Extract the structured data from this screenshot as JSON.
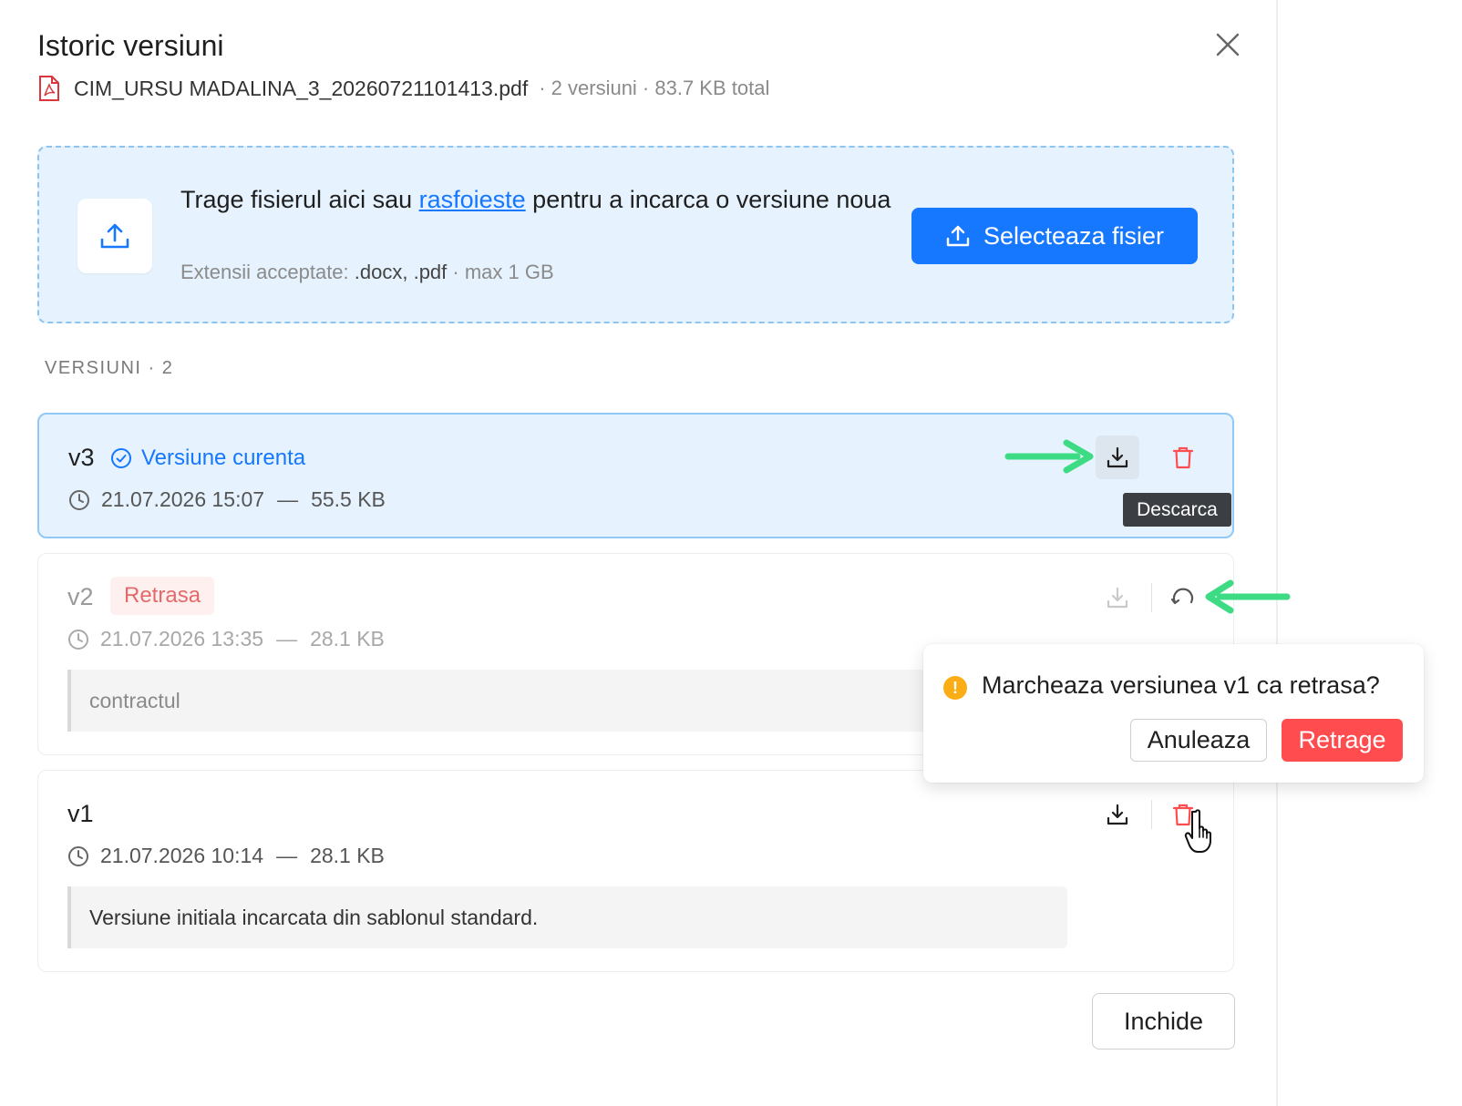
{
  "modal": {
    "title": "Istoric versiuni",
    "file_name": "CIM_URSU MADALINA_3_20260721101413.pdf",
    "file_meta": "· 2 versiuni · 83.7 KB total"
  },
  "dropzone": {
    "text_before": "Trage fisierul aici sau ",
    "link": "rasfoieste",
    "text_after": " pentru a incarca o versiune noua",
    "sub_label": "Extensii acceptate: ",
    "extensions": ".docx, .pdf",
    "max_size": " · max 1 GB",
    "button_label": "Selecteaza fisier"
  },
  "versions_label": "VERSIUNI · 2",
  "versions": [
    {
      "version": "v3",
      "status": "Versiune curenta",
      "date": "21.07.2026 15:07",
      "dash": "—",
      "size": "55.5 KB"
    },
    {
      "version": "v2",
      "status": "Retrasa",
      "date": "21.07.2026 13:35",
      "dash": "—",
      "size": "28.1 KB",
      "note": "contractul"
    },
    {
      "version": "v1",
      "date": "21.07.2026 10:14",
      "dash": "—",
      "size": "28.1 KB",
      "note": "Versiune initiala incarcata din sablonul standard."
    }
  ],
  "tooltip": "Descarca",
  "popconfirm": {
    "question": "Marcheaza versiunea v1 ca retrasa?",
    "cancel": "Anuleaza",
    "confirm": "Retrage",
    "warning_symbol": "!"
  },
  "footer": {
    "close": "Inchide"
  },
  "colors": {
    "primary": "#1677ff",
    "danger": "#ff4d4f",
    "current_bg": "#e6f3fe",
    "warning": "#faad14",
    "annotation_arrow": "#3ddc84"
  }
}
